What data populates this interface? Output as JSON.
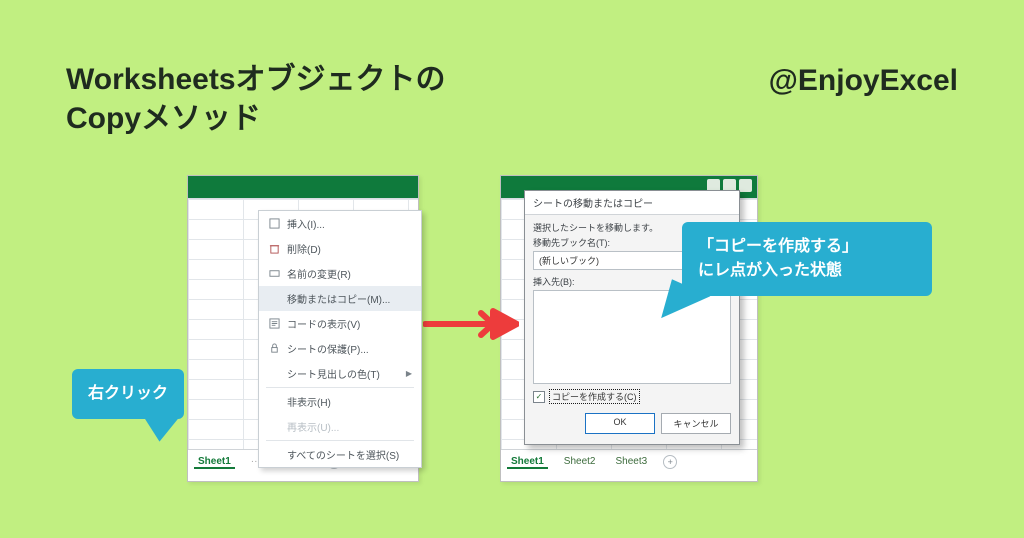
{
  "title_line1": "Worksheetsオブジェクトの",
  "title_line2": "Copyメソッド",
  "handle": "@EnjoyExcel",
  "left_tab": "Sheet1",
  "context_menu": {
    "insert": "挿入(I)...",
    "delete": "削除(D)",
    "rename": "名前の変更(R)",
    "move_copy": "移動またはコピー(M)...",
    "view_code": "コードの表示(V)",
    "protect": "シートの保護(P)...",
    "tab_color": "シート見出しの色(T)",
    "hide": "非表示(H)",
    "unhide": "再表示(U)...",
    "select_all": "すべてのシートを選択(S)"
  },
  "dialog": {
    "title": "シートの移動またはコピー",
    "desc": "選択したシートを移動します。",
    "book_label": "移動先ブック名(T):",
    "book_value": "(新しいブック)",
    "before_label": "挿入先(B):",
    "copy_checkbox": "コピーを作成する(C)",
    "ok": "OK",
    "cancel": "キャンセル"
  },
  "right_tabs": [
    "Sheet1",
    "Sheet2",
    "Sheet3"
  ],
  "callout_left": "右クリック",
  "callout_right_l1": "「コピーを作成する」",
  "callout_right_l2": "にレ点が入った状態"
}
